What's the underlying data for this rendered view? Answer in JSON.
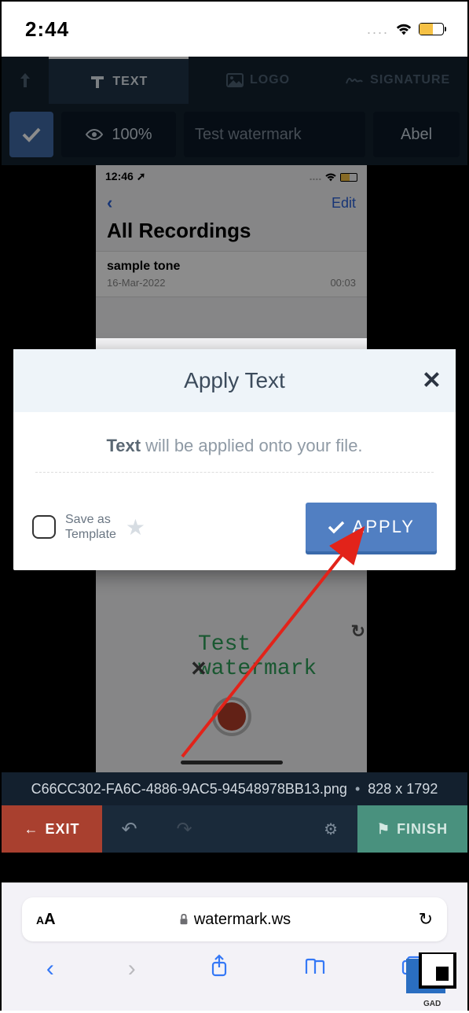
{
  "status": {
    "time": "2:44"
  },
  "tabs": {
    "text": "TEXT",
    "logo": "LOGO",
    "signature": "SIGNATURE"
  },
  "options": {
    "opacity": "100%",
    "watermark_text": "Test watermark",
    "font": "Abel"
  },
  "preview": {
    "time": "12:46",
    "edit": "Edit",
    "title": "All Recordings",
    "item_title": "sample tone",
    "item_date": "16-Mar-2022",
    "item_dur": "00:03",
    "watermark": "Test watermark"
  },
  "modal": {
    "title": "Apply Text",
    "msg_bold": "Text",
    "msg_rest": " will be applied onto your file.",
    "save_l1": "Save as",
    "save_l2": "Template",
    "apply": "APPLY"
  },
  "file": {
    "name": "C66CC302-FA6C-4886-9AC5-94548978BB13.png",
    "dims": "828 x 1792"
  },
  "actions": {
    "exit": "EXIT",
    "finish": "FINISH"
  },
  "browser": {
    "url": "watermark.ws"
  }
}
